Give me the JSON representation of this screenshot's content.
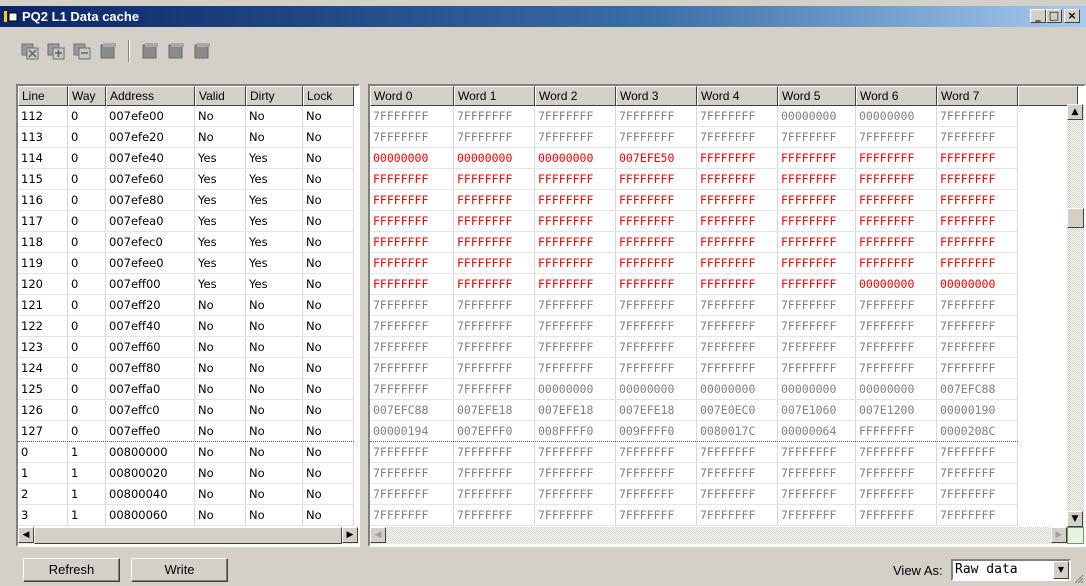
{
  "window": {
    "title": "PQ2 L1 Data cache",
    "buttons": {
      "minimize": "_",
      "maximize": "□",
      "close": "×"
    }
  },
  "toolbar": {
    "icons": [
      "cache-invalidate-icon",
      "cache-flush-icon",
      "cache-copy-icon",
      "cache-block-icon",
      "cache-lock-icon",
      "cache-unlock-icon",
      "cache-enable-icon"
    ]
  },
  "left_table": {
    "headers": [
      "Line",
      "Way",
      "Address",
      "Valid",
      "Dirty",
      "Lock"
    ],
    "rows": [
      [
        "112",
        "0",
        "007efe00",
        "No",
        "No",
        "No"
      ],
      [
        "113",
        "0",
        "007efe20",
        "No",
        "No",
        "No"
      ],
      [
        "114",
        "0",
        "007efe40",
        "Yes",
        "Yes",
        "No"
      ],
      [
        "115",
        "0",
        "007efe60",
        "Yes",
        "Yes",
        "No"
      ],
      [
        "116",
        "0",
        "007efe80",
        "Yes",
        "Yes",
        "No"
      ],
      [
        "117",
        "0",
        "007efea0",
        "Yes",
        "Yes",
        "No"
      ],
      [
        "118",
        "0",
        "007efec0",
        "Yes",
        "Yes",
        "No"
      ],
      [
        "119",
        "0",
        "007efee0",
        "Yes",
        "Yes",
        "No"
      ],
      [
        "120",
        "0",
        "007eff00",
        "Yes",
        "Yes",
        "No"
      ],
      [
        "121",
        "0",
        "007eff20",
        "No",
        "No",
        "No"
      ],
      [
        "122",
        "0",
        "007eff40",
        "No",
        "No",
        "No"
      ],
      [
        "123",
        "0",
        "007eff60",
        "No",
        "No",
        "No"
      ],
      [
        "124",
        "0",
        "007eff80",
        "No",
        "No",
        "No"
      ],
      [
        "125",
        "0",
        "007effa0",
        "No",
        "No",
        "No"
      ],
      [
        "126",
        "0",
        "007effc0",
        "No",
        "No",
        "No"
      ],
      [
        "127",
        "0",
        "007effe0",
        "No",
        "No",
        "No"
      ],
      [
        "0",
        "1",
        "00800000",
        "No",
        "No",
        "No"
      ],
      [
        "1",
        "1",
        "00800020",
        "No",
        "No",
        "No"
      ],
      [
        "2",
        "1",
        "00800040",
        "No",
        "No",
        "No"
      ],
      [
        "3",
        "1",
        "00800060",
        "No",
        "No",
        "No"
      ]
    ]
  },
  "right_table": {
    "headers": [
      "Word 0",
      "Word 1",
      "Word 2",
      "Word 3",
      "Word 4",
      "Word 5",
      "Word 6",
      "Word 7"
    ],
    "rows": [
      [
        "7FFFFFFF",
        "7FFFFFFF",
        "7FFFFFFF",
        "7FFFFFFF",
        "7FFFFFFF",
        "00000000",
        "00000000",
        "7FFFFFFF"
      ],
      [
        "7FFFFFFF",
        "7FFFFFFF",
        "7FFFFFFF",
        "7FFFFFFF",
        "7FFFFFFF",
        "7FFFFFFF",
        "7FFFFFFF",
        "7FFFFFFF"
      ],
      [
        "00000000",
        "00000000",
        "00000000",
        "007EFE50",
        "FFFFFFFF",
        "FFFFFFFF",
        "FFFFFFFF",
        "FFFFFFFF"
      ],
      [
        "FFFFFFFF",
        "FFFFFFFF",
        "FFFFFFFF",
        "FFFFFFFF",
        "FFFFFFFF",
        "FFFFFFFF",
        "FFFFFFFF",
        "FFFFFFFF"
      ],
      [
        "FFFFFFFF",
        "FFFFFFFF",
        "FFFFFFFF",
        "FFFFFFFF",
        "FFFFFFFF",
        "FFFFFFFF",
        "FFFFFFFF",
        "FFFFFFFF"
      ],
      [
        "FFFFFFFF",
        "FFFFFFFF",
        "FFFFFFFF",
        "FFFFFFFF",
        "FFFFFFFF",
        "FFFFFFFF",
        "FFFFFFFF",
        "FFFFFFFF"
      ],
      [
        "FFFFFFFF",
        "FFFFFFFF",
        "FFFFFFFF",
        "FFFFFFFF",
        "FFFFFFFF",
        "FFFFFFFF",
        "FFFFFFFF",
        "FFFFFFFF"
      ],
      [
        "FFFFFFFF",
        "FFFFFFFF",
        "FFFFFFFF",
        "FFFFFFFF",
        "FFFFFFFF",
        "FFFFFFFF",
        "FFFFFFFF",
        "FFFFFFFF"
      ],
      [
        "FFFFFFFF",
        "FFFFFFFF",
        "FFFFFFFF",
        "FFFFFFFF",
        "FFFFFFFF",
        "FFFFFFFF",
        "00000000",
        "00000000"
      ],
      [
        "7FFFFFFF",
        "7FFFFFFF",
        "7FFFFFFF",
        "7FFFFFFF",
        "7FFFFFFF",
        "7FFFFFFF",
        "7FFFFFFF",
        "7FFFFFFF"
      ],
      [
        "7FFFFFFF",
        "7FFFFFFF",
        "7FFFFFFF",
        "7FFFFFFF",
        "7FFFFFFF",
        "7FFFFFFF",
        "7FFFFFFF",
        "7FFFFFFF"
      ],
      [
        "7FFFFFFF",
        "7FFFFFFF",
        "7FFFFFFF",
        "7FFFFFFF",
        "7FFFFFFF",
        "7FFFFFFF",
        "7FFFFFFF",
        "7FFFFFFF"
      ],
      [
        "7FFFFFFF",
        "7FFFFFFF",
        "7FFFFFFF",
        "7FFFFFFF",
        "7FFFFFFF",
        "7FFFFFFF",
        "7FFFFFFF",
        "7FFFFFFF"
      ],
      [
        "7FFFFFFF",
        "7FFFFFFF",
        "00000000",
        "00000000",
        "00000000",
        "00000000",
        "00000000",
        "007EFC88"
      ],
      [
        "007EFC88",
        "007EFE18",
        "007EFE18",
        "007EFE18",
        "007E0EC0",
        "007E1060",
        "007E1200",
        "00000190"
      ],
      [
        "00000194",
        "007EFFF0",
        "008FFFF0",
        "009FFFF0",
        "0080017C",
        "00000064",
        "FFFFFFFF",
        "0000208C"
      ],
      [
        "7FFFFFFF",
        "7FFFFFFF",
        "7FFFFFFF",
        "7FFFFFFF",
        "7FFFFFFF",
        "7FFFFFFF",
        "7FFFFFFF",
        "7FFFFFFF"
      ],
      [
        "7FFFFFFF",
        "7FFFFFFF",
        "7FFFFFFF",
        "7FFFFFFF",
        "7FFFFFFF",
        "7FFFFFFF",
        "7FFFFFFF",
        "7FFFFFFF"
      ],
      [
        "7FFFFFFF",
        "7FFFFFFF",
        "7FFFFFFF",
        "7FFFFFFF",
        "7FFFFFFF",
        "7FFFFFFF",
        "7FFFFFFF",
        "7FFFFFFF"
      ],
      [
        "7FFFFFFF",
        "7FFFFFFF",
        "7FFFFFFF",
        "7FFFFFFF",
        "7FFFFFFF",
        "7FFFFFFF",
        "7FFFFFFF",
        "7FFFFFFF"
      ]
    ],
    "row_colors": [
      "gray",
      "gray",
      "red",
      "red",
      "red",
      "red",
      "red",
      "red",
      "red",
      "gray",
      "gray",
      "gray",
      "gray",
      "gray",
      "gray",
      "gray",
      "gray",
      "gray",
      "gray",
      "gray"
    ]
  },
  "buttons": {
    "refresh": "Refresh",
    "write": "Write"
  },
  "view_as": {
    "label": "View As:",
    "value": "Raw data"
  },
  "colors": {
    "dirty_data": "#ff0000",
    "clean_data": "#808080",
    "title_bar": "#0a246a"
  }
}
